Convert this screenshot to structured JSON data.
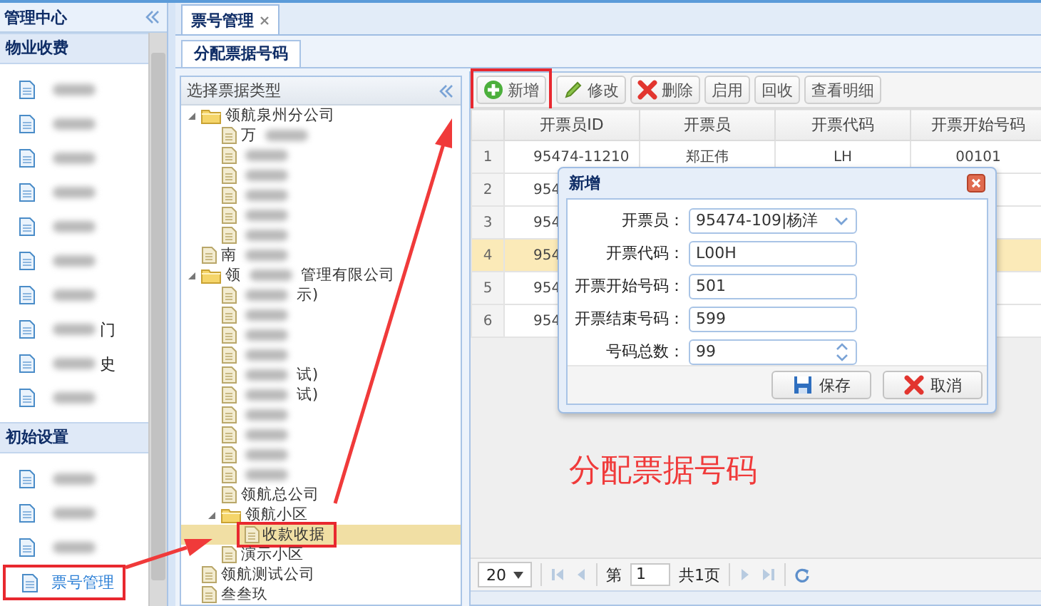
{
  "sidebar": {
    "title": "管理中心",
    "sections": [
      {
        "title": "物业收费",
        "items": [
          {
            "blur": true,
            "selected": false
          },
          {
            "blur": true,
            "selected": false
          },
          {
            "blur": true,
            "selected": false
          },
          {
            "blur": true,
            "selected": false
          },
          {
            "blur": true,
            "selected": false
          },
          {
            "blur": true,
            "selected": false
          },
          {
            "blur": true,
            "selected": false
          },
          {
            "blur": true,
            "tail": "门",
            "selected": false
          },
          {
            "blur": true,
            "tail": "史",
            "selected": false
          },
          {
            "blur": true,
            "selected": false
          }
        ]
      },
      {
        "title": "初始设置",
        "items": [
          {
            "blur": true,
            "selected": false
          },
          {
            "blur": true,
            "selected": false
          },
          {
            "blur": true,
            "selected": false
          },
          {
            "label": "票号管理",
            "selected": true
          }
        ]
      }
    ]
  },
  "tabs": [
    {
      "label": "票号管理",
      "closable": true,
      "selected": true
    }
  ],
  "subtabs": [
    {
      "label": "分配票据号码",
      "selected": true
    }
  ],
  "tree": {
    "title": "选择票据类型",
    "nodes": [
      {
        "kind": "folder",
        "label": "领航泉州分公司",
        "expanded": true,
        "selected": false,
        "children": [
          {
            "kind": "leaf",
            "label": "万",
            "blur": true,
            "selected": false
          },
          {
            "kind": "leaf",
            "blur": true,
            "selected": false
          },
          {
            "kind": "leaf",
            "blur": true,
            "selected": false
          },
          {
            "kind": "leaf",
            "blur": true,
            "selected": false
          },
          {
            "kind": "leaf",
            "blur": true,
            "selected": false
          },
          {
            "kind": "leaf",
            "blur": true,
            "selected": false
          }
        ]
      },
      {
        "kind": "leaf",
        "label": "南",
        "blur": true,
        "selected": false
      },
      {
        "kind": "folder",
        "label": "领",
        "blur": true,
        "tail": "管理有限公司",
        "expanded": true,
        "selected": false,
        "children": [
          {
            "kind": "leaf",
            "blur": true,
            "tail": "示)",
            "selected": false
          },
          {
            "kind": "leaf",
            "blur": true,
            "selected": false
          },
          {
            "kind": "leaf",
            "blur": true,
            "selected": false
          },
          {
            "kind": "leaf",
            "blur": true,
            "selected": false
          },
          {
            "kind": "leaf",
            "blur": true,
            "tail": "试)",
            "selected": false
          },
          {
            "kind": "leaf",
            "blur": true,
            "tail": "试)",
            "selected": false
          },
          {
            "kind": "leaf",
            "blur": true,
            "selected": false
          },
          {
            "kind": "leaf",
            "blur": true,
            "selected": false
          },
          {
            "kind": "leaf",
            "blur": true,
            "selected": false
          },
          {
            "kind": "leaf",
            "blur": true,
            "selected": false
          },
          {
            "kind": "leaf",
            "label": "领航总公司",
            "selected": false
          },
          {
            "kind": "folder",
            "label": "领航小区",
            "expanded": true,
            "selected": false,
            "children": [
              {
                "kind": "leaf",
                "label": "收款收据",
                "selected": true
              }
            ]
          },
          {
            "kind": "leaf",
            "label": "演示小区",
            "selected": false
          }
        ]
      },
      {
        "kind": "leaf",
        "label": "领航测试公司",
        "selected": false
      },
      {
        "kind": "leaf",
        "label": "叁叁玖",
        "selected": false
      }
    ]
  },
  "toolbar": [
    {
      "label": "新增",
      "kind": "add",
      "highlighted": true
    },
    {
      "label": "修改",
      "kind": "edit",
      "highlighted": false
    },
    {
      "label": "删除",
      "kind": "delete",
      "highlighted": false
    },
    {
      "label": "启用",
      "kind": "plain",
      "highlighted": false
    },
    {
      "label": "回收",
      "kind": "plain",
      "highlighted": false
    },
    {
      "label": "查看明细",
      "kind": "plain",
      "highlighted": false
    }
  ],
  "table": {
    "columns": [
      "开票员ID",
      "开票员",
      "开票代码",
      "开票开始号码"
    ],
    "rows": [
      {
        "number": "1",
        "cells": [
          "95474-11210",
          "郑正伟",
          "LH",
          "00101"
        ],
        "selected": false
      },
      {
        "number": "2",
        "cells": [
          "954"
        ],
        "selected": false
      },
      {
        "number": "3",
        "cells": [
          "954"
        ],
        "selected": false
      },
      {
        "number": "4",
        "cells": [
          "954"
        ],
        "selected": true
      },
      {
        "number": "5",
        "cells": [
          "954"
        ],
        "selected": false
      },
      {
        "number": "6",
        "cells": [
          "954"
        ],
        "selected": false
      }
    ]
  },
  "pager": {
    "page_size": "20",
    "page_prefix": "第",
    "page": "1",
    "page_total": "共1页"
  },
  "dialog": {
    "title": "新增",
    "fields": [
      {
        "label": "开票员：",
        "value": "95474-109|杨洋",
        "kind": "combo"
      },
      {
        "label": "开票代码：",
        "value": "L00H",
        "kind": "text"
      },
      {
        "label": "开票开始号码：",
        "value": "501",
        "kind": "text"
      },
      {
        "label": "开票结束号码：",
        "value": "599",
        "kind": "text"
      },
      {
        "label": "号码总数：",
        "value": "99",
        "kind": "spinner"
      }
    ],
    "buttons": [
      {
        "label": "保存",
        "kind": "save"
      },
      {
        "label": "取消",
        "kind": "cancel"
      }
    ]
  },
  "annotation": "分配票据号码"
}
